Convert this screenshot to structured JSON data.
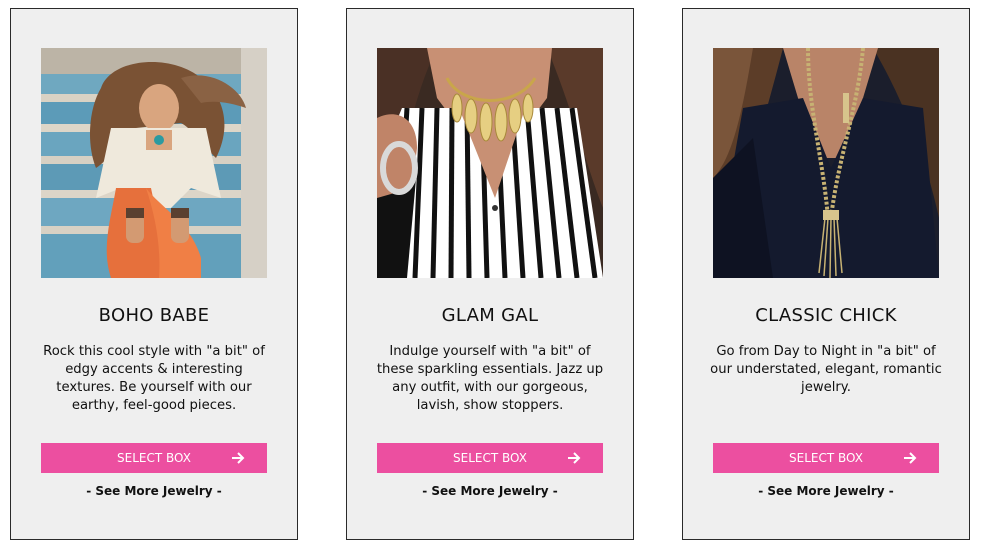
{
  "colors": {
    "card_background": "#efefef",
    "card_border": "#2a2a2a",
    "button_pink": "#ec4fa0",
    "button_text": "#ffffff"
  },
  "cards": [
    {
      "image_icon": "boho-woman-on-blue-stairs-photo",
      "title": "BOHO BABE",
      "description": "Rock this cool style with \"a bit\" of edgy accents & interesting textures. Be yourself with our earthy, feel-good pieces.",
      "button_label": "SELECT BOX",
      "button_icon": "arrow-right-icon",
      "link_label": "- See More Jewelry -"
    },
    {
      "image_icon": "statement-necklace-striped-shirt-photo",
      "title": "GLAM GAL",
      "description": "Indulge yourself with \"a bit\" of these sparkling essentials. Jazz up any outfit, with our gorgeous, lavish, show stoppers.",
      "button_label": "SELECT BOX",
      "button_icon": "arrow-right-icon",
      "link_label": "- See More Jewelry -"
    },
    {
      "image_icon": "long-gold-chain-navy-top-photo",
      "title": "CLASSIC CHICK",
      "description": "Go from Day to Night in \"a bit\" of our understated, elegant, romantic jewelry.",
      "button_label": "SELECT BOX",
      "button_icon": "arrow-right-icon",
      "link_label": "- See More Jewelry -"
    }
  ]
}
